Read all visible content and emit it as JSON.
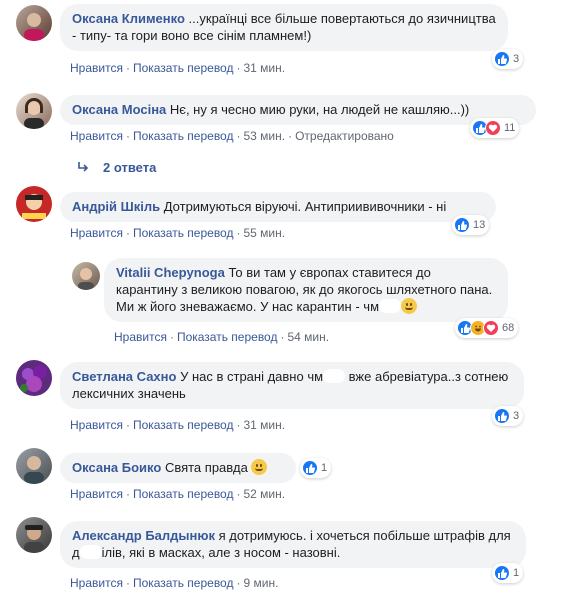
{
  "labels": {
    "like": "Нравится",
    "translate": "Показать перевод",
    "edited": "Отредактировано",
    "sep": "·"
  },
  "comments": [
    {
      "author": "Оксана Клименко",
      "text": "...українці все більше повертаються до язичництва - типу- та гори воно все сінім пламнем!)",
      "time": "31 мин.",
      "reactions": "3"
    },
    {
      "author": "Оксана Мосіна",
      "text": "Нє, ну я чесно мию руки, на людей не кашляю...))",
      "time": "53 мин.",
      "reactions": "11"
    },
    {
      "author": "Андрій Шкіль",
      "text": "Дотримуються віруючі. Антиприививочники - ні",
      "time": "55 мин.",
      "reactions": "13"
    },
    {
      "author": "Светлана Сахно",
      "text_a": "У нас в страні давно чм",
      "text_b": "вже абревіатура..з сотнею лексичних значень",
      "time": "31 мин.",
      "reactions": "3"
    },
    {
      "author": "Оксана Боико",
      "text": "Свята правда",
      "time": "52 мин.",
      "reactions": "1"
    },
    {
      "author": "Александр Балдынюк",
      "text_a": "я дотримуюсь. і хочеться побільше штрафів для д",
      "text_b": "ілів, які в масках, але з носом - назовні.",
      "time": "9 мин.",
      "reactions": "1"
    }
  ],
  "replies_link": "2 ответа",
  "reply": {
    "author": "Vitalii Chepynoga",
    "text": "То ви там у європах ставитеся до карантину з великою повагою, як до якогось шляхетного пана. Ми ж його зневажаємо. У нас карантин - чм",
    "time": "54 мин.",
    "reactions": "68"
  },
  "colors": {
    "link": "#385898",
    "bubble": "#f2f3f5",
    "like": "#1877f2",
    "love": "#f33e58",
    "haha": "#f7b125"
  }
}
